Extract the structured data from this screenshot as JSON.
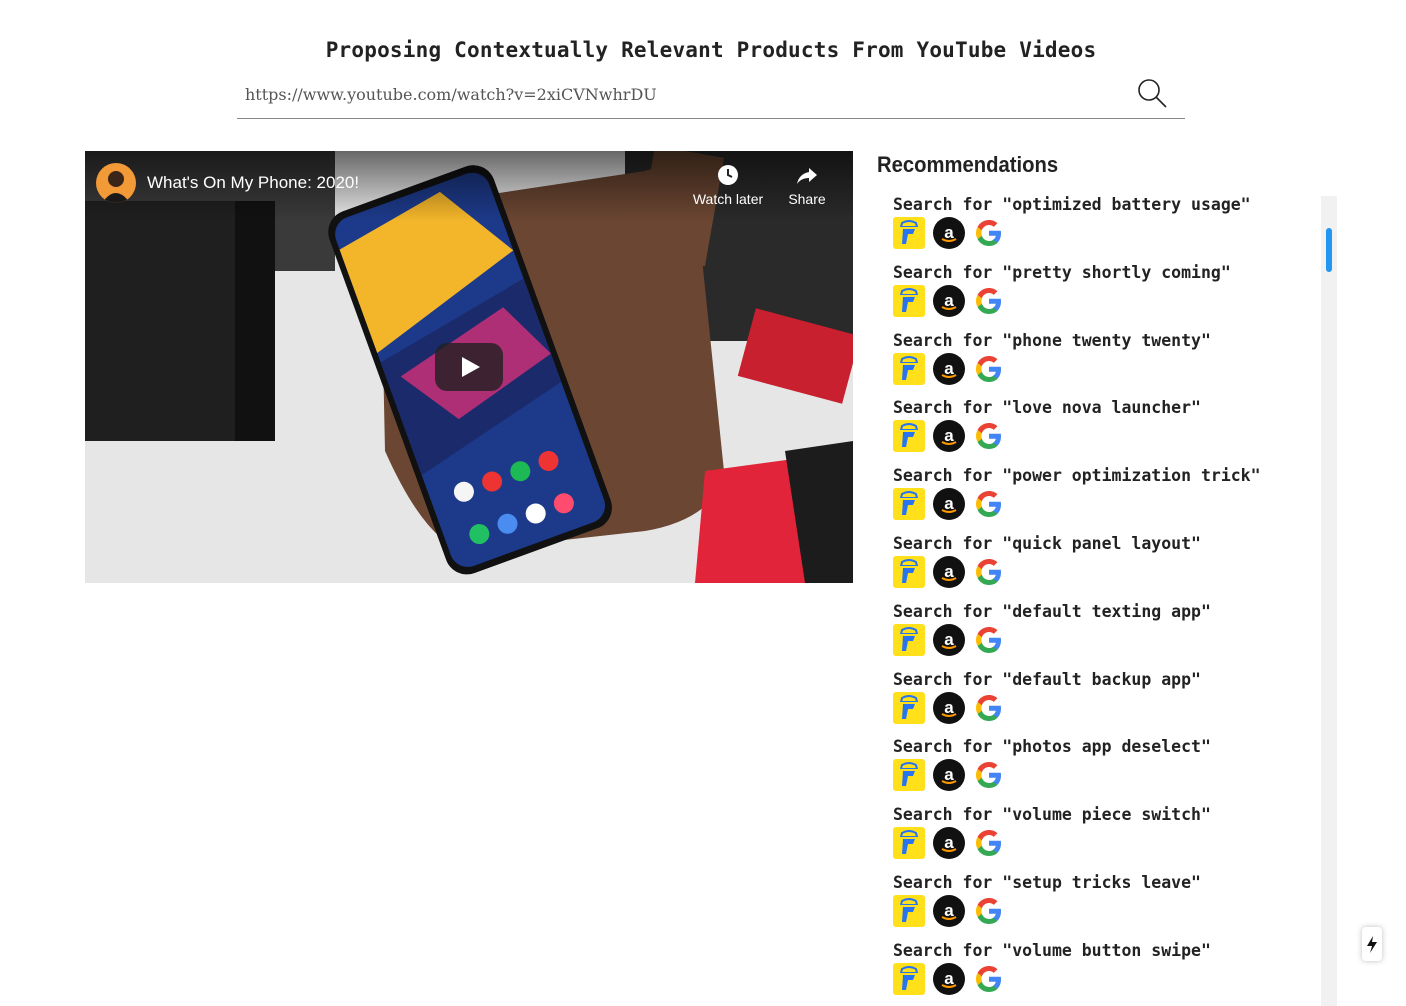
{
  "header": {
    "title": "Proposing Contextually Relevant Products From YouTube Videos"
  },
  "search": {
    "value": "https://www.youtube.com/watch?v=2xiCVNwhrDU",
    "button_icon": "search-icon"
  },
  "video": {
    "title": "What's On My Phone: 2020!",
    "watch_later_label": "Watch later",
    "share_label": "Share",
    "icons": [
      "clock-icon",
      "share-arrow-icon",
      "play-icon"
    ]
  },
  "recommendations": {
    "heading": "Recommendations",
    "items": [
      {
        "label": "Search for \"optimized battery usage\""
      },
      {
        "label": "Search for \"pretty shortly coming\""
      },
      {
        "label": "Search for \"phone twenty twenty\""
      },
      {
        "label": "Search for \"love nova launcher\""
      },
      {
        "label": "Search for \"power optimization trick\""
      },
      {
        "label": "Search for \"quick panel layout\""
      },
      {
        "label": "Search for \"default texting app\""
      },
      {
        "label": "Search for \"default backup app\""
      },
      {
        "label": "Search for \"photos app deselect\""
      },
      {
        "label": "Search for \"volume piece switch\""
      },
      {
        "label": "Search for \"setup tricks leave\""
      },
      {
        "label": "Search for \"volume button swipe\""
      }
    ],
    "store_icons": [
      "flipkart-icon",
      "amazon-icon",
      "google-icon"
    ]
  },
  "colors": {
    "scroll_thumb": "#2196f3",
    "flipkart": "#ffe01b",
    "amazon": "#111111"
  }
}
